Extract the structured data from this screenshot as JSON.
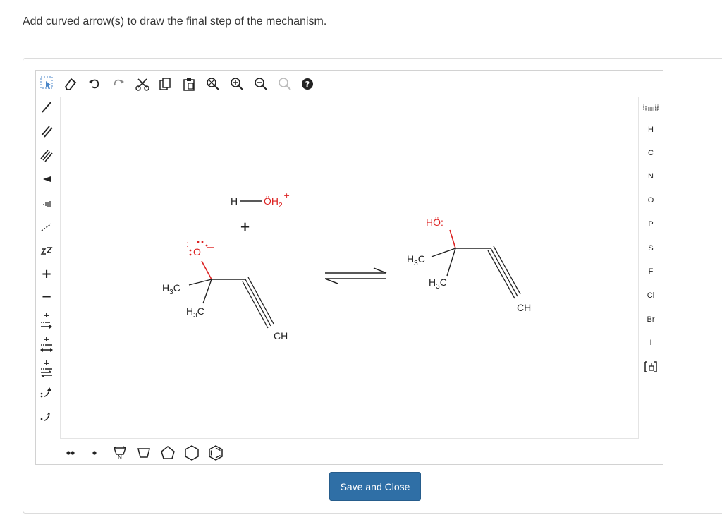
{
  "question": {
    "prompt": "Add curved arrow(s) to draw the final step of the mechanism."
  },
  "toolbar_top": [
    {
      "name": "select-lasso-tool",
      "icon": "lasso-select-icon"
    },
    {
      "name": "erase-tool",
      "icon": "eraser-icon"
    },
    {
      "name": "undo-tool",
      "icon": "undo-icon"
    },
    {
      "name": "redo-tool",
      "icon": "redo-icon"
    },
    {
      "name": "cut-tool",
      "icon": "scissors-icon"
    },
    {
      "name": "copy-tool",
      "icon": "copy-icon"
    },
    {
      "name": "paste-tool",
      "icon": "paste-icon"
    },
    {
      "name": "zoom-fit-tool",
      "icon": "zoom-fit-icon"
    },
    {
      "name": "zoom-in-tool",
      "icon": "zoom-in-icon"
    },
    {
      "name": "zoom-out-tool",
      "icon": "zoom-out-icon"
    },
    {
      "name": "zoom-reset-tool",
      "icon": "zoom-reset-icon"
    },
    {
      "name": "help-tool",
      "icon": "help-icon"
    }
  ],
  "toolbar_left": [
    {
      "name": "single-bond-tool",
      "icon": "single-bond-icon"
    },
    {
      "name": "double-bond-tool",
      "icon": "double-bond-icon"
    },
    {
      "name": "triple-bond-tool",
      "icon": "triple-bond-icon"
    },
    {
      "name": "wedge-bond-tool",
      "icon": "wedge-bond-icon"
    },
    {
      "name": "hash-bond-tool",
      "icon": "hash-bond-icon"
    },
    {
      "name": "dashed-bond-tool",
      "icon": "dashed-bond-icon"
    },
    {
      "name": "chain-tool",
      "icon": "chain-icon"
    },
    {
      "name": "positive-charge-tool",
      "icon": "plus-charge-icon",
      "label": "+"
    },
    {
      "name": "negative-charge-tool",
      "icon": "minus-charge-icon",
      "label": "−"
    },
    {
      "name": "reaction-arrow-tool",
      "icon": "reaction-arrow-icon"
    },
    {
      "name": "equilibrium-arrow-tool",
      "icon": "double-arrow-icon"
    },
    {
      "name": "resonance-arrow-tool",
      "icon": "equilibrium-arrow-icon"
    },
    {
      "name": "electron-pair-arrow-tool",
      "icon": "curved-arrow-pair-icon"
    },
    {
      "name": "single-electron-arrow-tool",
      "icon": "curved-arrow-single-icon"
    }
  ],
  "elements": [
    "H",
    "C",
    "N",
    "O",
    "P",
    "S",
    "F",
    "Cl",
    "Br",
    "I"
  ],
  "shapes_bottom": [
    {
      "name": "lone-pair-tool",
      "icon": "lone-pair-icon"
    },
    {
      "name": "radical-tool",
      "icon": "radical-icon"
    },
    {
      "name": "pyrrole-ring-tool",
      "icon": "pyrrole-icon",
      "label": "N"
    },
    {
      "name": "cyclopentane-tool",
      "icon": "pentagon-icon"
    },
    {
      "name": "cyclopentagon-tool",
      "icon": "pentagon-up-icon"
    },
    {
      "name": "cyclohexane-tool",
      "icon": "hexagon-icon"
    },
    {
      "name": "benzene-tool",
      "icon": "benzene-icon"
    }
  ],
  "molecules": {
    "reactant": {
      "o_label": "O",
      "me1_label": "H",
      "me1_sub": "3",
      "me1_tail": "C",
      "me2_label": "H",
      "me2_sub": "3",
      "me2_tail": "C",
      "ch_label": "CH"
    },
    "hydronium": {
      "h_label": "H",
      "o_label": "ÖH",
      "sub": "2",
      "charge": "+",
      "plus": "+"
    },
    "product": {
      "o_label": "HÖ:",
      "me1_label": "H",
      "me1_sub": "3",
      "me1_tail": "C",
      "me2_label": "H",
      "me2_sub": "3",
      "me2_tail": "C",
      "ch_label": "CH"
    }
  },
  "buttons": {
    "save": "Save and Close"
  },
  "colors": {
    "oxygen": "#dd2222",
    "button": "#2f6fa6",
    "ink": "#222222"
  }
}
